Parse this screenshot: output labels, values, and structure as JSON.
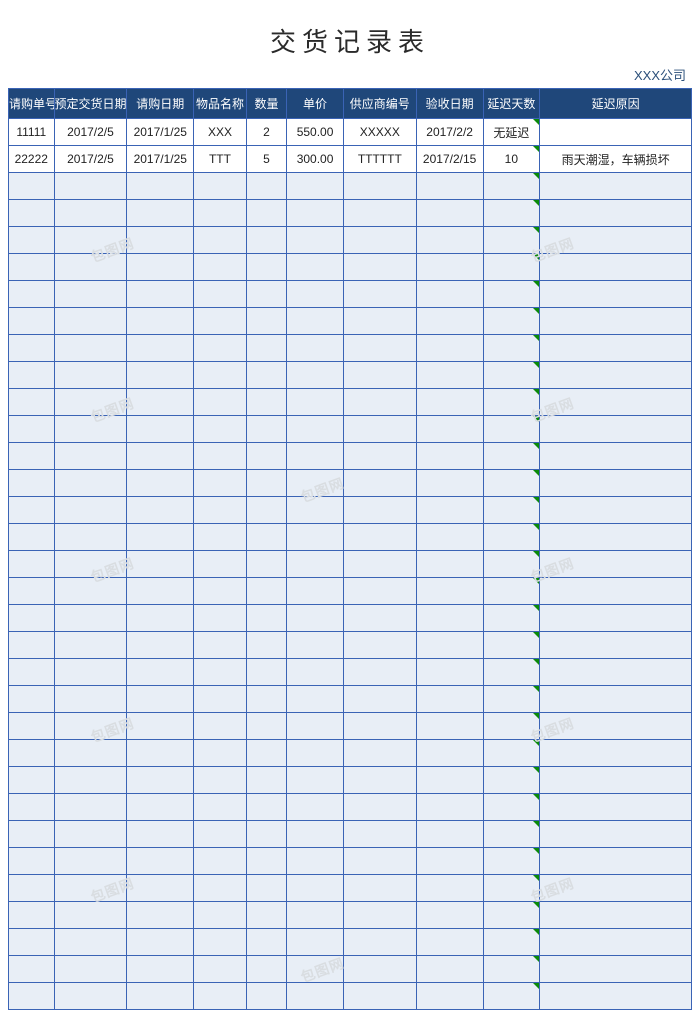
{
  "title": "交货记录表",
  "company": "XXX公司",
  "watermark": "包图网",
  "headers": [
    "请购单号",
    "预定交货日期",
    "请购日期",
    "物品名称",
    "数量",
    "单价",
    "供应商编号",
    "验收日期",
    "延迟天数",
    "延迟原因"
  ],
  "rows": [
    {
      "c0": "11111",
      "c1": "2017/2/5",
      "c2": "2017/1/25",
      "c3": "XXX",
      "c4": "2",
      "c5": "550.00",
      "c6": "XXXXX",
      "c7": "2017/2/2",
      "c8": "无延迟",
      "c9": ""
    },
    {
      "c0": "22222",
      "c1": "2017/2/5",
      "c2": "2017/1/25",
      "c3": "TTT",
      "c4": "5",
      "c5": "300.00",
      "c6": "TTTTTT",
      "c7": "2017/2/15",
      "c8": "10",
      "c9": "雨天潮湿，车辆损坏"
    }
  ],
  "empty_rows": 31
}
